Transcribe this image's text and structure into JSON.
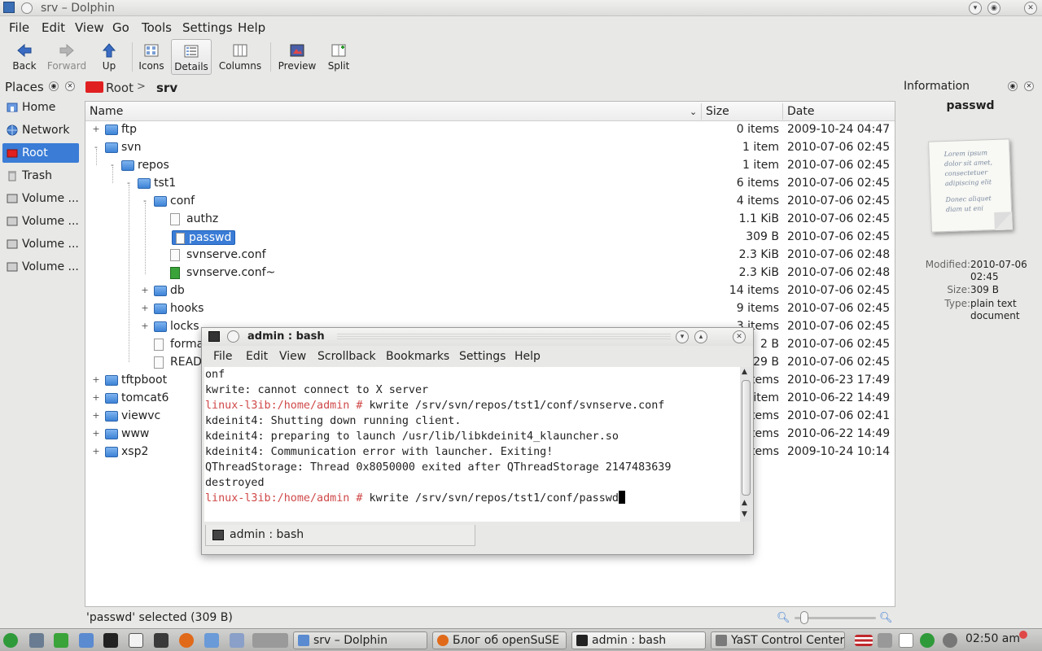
{
  "window": {
    "title": "srv – Dolphin"
  },
  "menubar": [
    "File",
    "Edit",
    "View",
    "Go",
    "Tools",
    "Settings",
    "Help"
  ],
  "toolbar": {
    "back": "Back",
    "forward": "Forward",
    "up": "Up",
    "icons": "Icons",
    "details": "Details",
    "columns": "Columns",
    "preview": "Preview",
    "split": "Split"
  },
  "places": {
    "header": "Places",
    "items": [
      {
        "label": "Home",
        "icon": "home-icon"
      },
      {
        "label": "Network",
        "icon": "network-icon"
      },
      {
        "label": "Root",
        "icon": "root-folder-icon",
        "selected": true
      },
      {
        "label": "Trash",
        "icon": "trash-icon"
      },
      {
        "label": "Volume ...",
        "icon": "drive-icon"
      },
      {
        "label": "Volume ...",
        "icon": "drive-icon"
      },
      {
        "label": "Volume ...",
        "icon": "drive-icon"
      },
      {
        "label": "Volume ...",
        "icon": "drive-icon"
      }
    ]
  },
  "breadcrumb": {
    "root": "Root",
    "separator": ">",
    "current": "srv"
  },
  "columns": {
    "name": "Name",
    "size": "Size",
    "date": "Date"
  },
  "files": [
    {
      "name": "ftp",
      "size": "0 items",
      "date": "2009-10-24 04:47"
    },
    {
      "name": "svn",
      "size": "1 item",
      "date": "2010-07-06 02:45"
    },
    {
      "name": "repos",
      "size": "1 item",
      "date": "2010-07-06 02:45"
    },
    {
      "name": "tst1",
      "size": "6 items",
      "date": "2010-07-06 02:45"
    },
    {
      "name": "conf",
      "size": "4 items",
      "date": "2010-07-06 02:45"
    },
    {
      "name": "authz",
      "size": "1.1 KiB",
      "date": "2010-07-06 02:45"
    },
    {
      "name": "passwd",
      "size": "309 B",
      "date": "2010-07-06 02:45"
    },
    {
      "name": "svnserve.conf",
      "size": "2.3 KiB",
      "date": "2010-07-06 02:48"
    },
    {
      "name": "svnserve.conf~",
      "size": "2.3 KiB",
      "date": "2010-07-06 02:48"
    },
    {
      "name": "db",
      "size": "14 items",
      "date": "2010-07-06 02:45"
    },
    {
      "name": "hooks",
      "size": "9 items",
      "date": "2010-07-06 02:45"
    },
    {
      "name": "locks",
      "size": "3 items",
      "date": "2010-07-06 02:45"
    },
    {
      "name": "forma",
      "size": "2 B",
      "date": "2010-07-06 02:45"
    },
    {
      "name": "READ",
      "size": "229 B",
      "date": "2010-07-06 02:45"
    },
    {
      "name": "tftpboot",
      "size": "items",
      "date": "2010-06-23 17:49"
    },
    {
      "name": "tomcat6",
      "size": "item",
      "date": "2010-06-22 14:49"
    },
    {
      "name": "viewvc",
      "size": "items",
      "date": "2010-07-06 02:41"
    },
    {
      "name": "www",
      "size": "items",
      "date": "2010-06-22 14:49"
    },
    {
      "name": "xsp2",
      "size": "items",
      "date": "2009-10-24 10:14"
    }
  ],
  "info": {
    "header": "Information",
    "filename": "passwd",
    "preview_text": [
      "Lorem ipsum",
      "dolor sit amet,",
      "consectetuer",
      "adipiscing elit",
      "",
      "Donec aliquet",
      "diam ut eni"
    ],
    "modified_label": "Modified:",
    "modified_value": "2010-07-06 02:45",
    "size_label": "Size:",
    "size_value": "309 B",
    "type_label": "Type:",
    "type_value": "plain text document"
  },
  "status": {
    "text": "'passwd' selected (309 B)",
    "zoom_level": 0.05
  },
  "konsole": {
    "title": "admin : bash",
    "menu": [
      "File",
      "Edit",
      "View",
      "Scrollback",
      "Bookmarks",
      "Settings",
      "Help"
    ],
    "lines": [
      {
        "text": "onf"
      },
      {
        "text": "kwrite: cannot connect to X server"
      },
      {
        "prompt": "linux-l3ib:/home/admin # ",
        "text": "kwrite /srv/svn/repos/tst1/conf/svnserve.conf"
      },
      {
        "text": "kdeinit4: Shutting down running client."
      },
      {
        "text": "kdeinit4: preparing to launch /usr/lib/libkdeinit4_klauncher.so"
      },
      {
        "text": "kdeinit4: Communication error with launcher. Exiting!"
      },
      {
        "text": "QThreadStorage: Thread 0x8050000 exited after QThreadStorage 2147483639"
      },
      {
        "text": "destroyed"
      },
      {
        "prompt": "linux-l3ib:/home/admin # ",
        "text": "kwrite /srv/svn/repos/tst1/conf/passwd",
        "cursor": true
      }
    ],
    "tab_label": "admin : bash"
  },
  "taskbar": {
    "tasks": [
      {
        "label": "srv – Dolphin",
        "active": false
      },
      {
        "label": "Блог об openSuSE",
        "active": false
      },
      {
        "label": "admin : bash",
        "active": true
      },
      {
        "label": "YaST Control Center",
        "active": false
      }
    ],
    "clock": "02:50 am"
  },
  "colors": {
    "selection": "#3a7cd6",
    "prompt": "#d04848",
    "root_folder": "#e02020"
  }
}
